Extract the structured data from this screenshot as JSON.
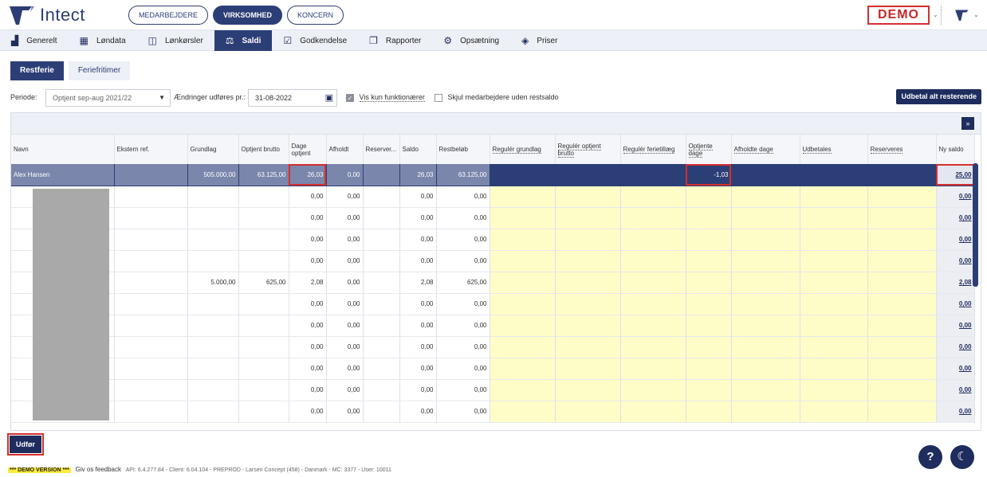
{
  "app": {
    "name": "Intect",
    "demo_badge": "DEMO"
  },
  "main_nav": [
    {
      "label": "MEDARBEJDERE",
      "active": false
    },
    {
      "label": "VIRKSOMHED",
      "active": true
    },
    {
      "label": "KONCERN",
      "active": false
    }
  ],
  "sub_nav": [
    {
      "label": "Generelt",
      "icon": "factory-icon",
      "glyph": "▟"
    },
    {
      "label": "Løndata",
      "icon": "grid-icon",
      "glyph": "▦"
    },
    {
      "label": "Lønkørsler",
      "icon": "book-icon",
      "glyph": "◫"
    },
    {
      "label": "Saldi",
      "icon": "scale-icon",
      "glyph": "⚖",
      "active": true
    },
    {
      "label": "Godkendelse",
      "icon": "calendar-check-icon",
      "glyph": "☑"
    },
    {
      "label": "Rapporter",
      "icon": "copy-icon",
      "glyph": "❐"
    },
    {
      "label": "Opsætning",
      "icon": "gear-icon",
      "glyph": "⚙"
    },
    {
      "label": "Priser",
      "icon": "diamond-icon",
      "glyph": "◈"
    }
  ],
  "tabs": [
    {
      "label": "Restferie",
      "active": true
    },
    {
      "label": "Feriefritimer",
      "active": false
    }
  ],
  "filters": {
    "period_label": "Periode:",
    "period_value": "Optjent sep-aug 2021/22",
    "changes_label": "Ændringer udføres pr.:",
    "date_value": "31-08-2022",
    "only_officials_label": "Vis kun funktionærer",
    "hide_no_balance_label": "Skjul medarbejdere uden restsaldo",
    "pay_all_label": "Udbetal alt resterende"
  },
  "columns": [
    "Navn",
    "Ekstern ref.",
    "Grundlag",
    "Optjent brutto",
    "Dage optjent",
    "Afholdt",
    "Reserver...",
    "Saldo",
    "Restbeløb",
    "Regulér grundlag",
    "Regulér optjent brutto",
    "Regulér ferietillæg",
    "Optjente dage",
    "Afholdte dage",
    "Udbetales",
    "Reserveres",
    "Ny saldo"
  ],
  "selected_row": {
    "name": "Alex Hansen",
    "ext": "",
    "grundlag": "505.000,00",
    "optjent": "63.125,00",
    "dage": "26,03",
    "afholdt": "0,00",
    "reserver": "",
    "saldo": "26,03",
    "restbelob": "63.125,00",
    "optjente_dage": "-1,03",
    "ny_saldo": "25,00"
  },
  "rows": [
    {
      "grundlag": "",
      "optjent": "",
      "dage": "0,00",
      "afholdt": "0,00",
      "saldo": "0,00",
      "restbelob": "0,00",
      "ny_saldo": "0,00"
    },
    {
      "grundlag": "",
      "optjent": "",
      "dage": "0,00",
      "afholdt": "0,00",
      "saldo": "0,00",
      "restbelob": "0,00",
      "ny_saldo": "0,00"
    },
    {
      "grundlag": "",
      "optjent": "",
      "dage": "0,00",
      "afholdt": "0,00",
      "saldo": "0,00",
      "restbelob": "0,00",
      "ny_saldo": "0,00"
    },
    {
      "grundlag": "",
      "optjent": "",
      "dage": "0,00",
      "afholdt": "0,00",
      "saldo": "0,00",
      "restbelob": "0,00",
      "ny_saldo": "0,00"
    },
    {
      "grundlag": "5.000,00",
      "optjent": "625,00",
      "dage": "2,08",
      "afholdt": "0,00",
      "saldo": "2,08",
      "restbelob": "625,00",
      "ny_saldo": "2,08"
    },
    {
      "grundlag": "",
      "optjent": "",
      "dage": "0,00",
      "afholdt": "0,00",
      "saldo": "0,00",
      "restbelob": "0,00",
      "ny_saldo": "0,00"
    },
    {
      "grundlag": "",
      "optjent": "",
      "dage": "0,00",
      "afholdt": "0,00",
      "saldo": "0,00",
      "restbelob": "0,00",
      "ny_saldo": "0,00"
    },
    {
      "grundlag": "",
      "optjent": "",
      "dage": "0,00",
      "afholdt": "0,00",
      "saldo": "0,00",
      "restbelob": "0,00",
      "ny_saldo": "0,00"
    },
    {
      "grundlag": "",
      "optjent": "",
      "dage": "0,00",
      "afholdt": "0,00",
      "saldo": "0,00",
      "restbelob": "0,00",
      "ny_saldo": "0,00"
    },
    {
      "grundlag": "",
      "optjent": "",
      "dage": "0,00",
      "afholdt": "0,00",
      "saldo": "0,00",
      "restbelob": "0,00",
      "ny_saldo": "0,00"
    },
    {
      "grundlag": "",
      "optjent": "",
      "dage": "0,00",
      "afholdt": "0,00",
      "saldo": "0,00",
      "restbelob": "0,00",
      "ny_saldo": "0,00"
    }
  ],
  "actions": {
    "execute_label": "Udfør",
    "help_glyph": "?",
    "theme_glyph": "☾"
  },
  "footer": {
    "demo_version": "*** DEMO VERSION ***",
    "feedback": "Giv os feedback",
    "version_info": "API: 6.4.277.84 - Client: 6.04.104 - PREPROD - Larsen Concept (458) - Danmark - MC: 3377 - User: 10011"
  },
  "colors": {
    "brand": "#2c3e76",
    "highlight": "#d52f2f",
    "edit_cell": "#fffdc7"
  }
}
